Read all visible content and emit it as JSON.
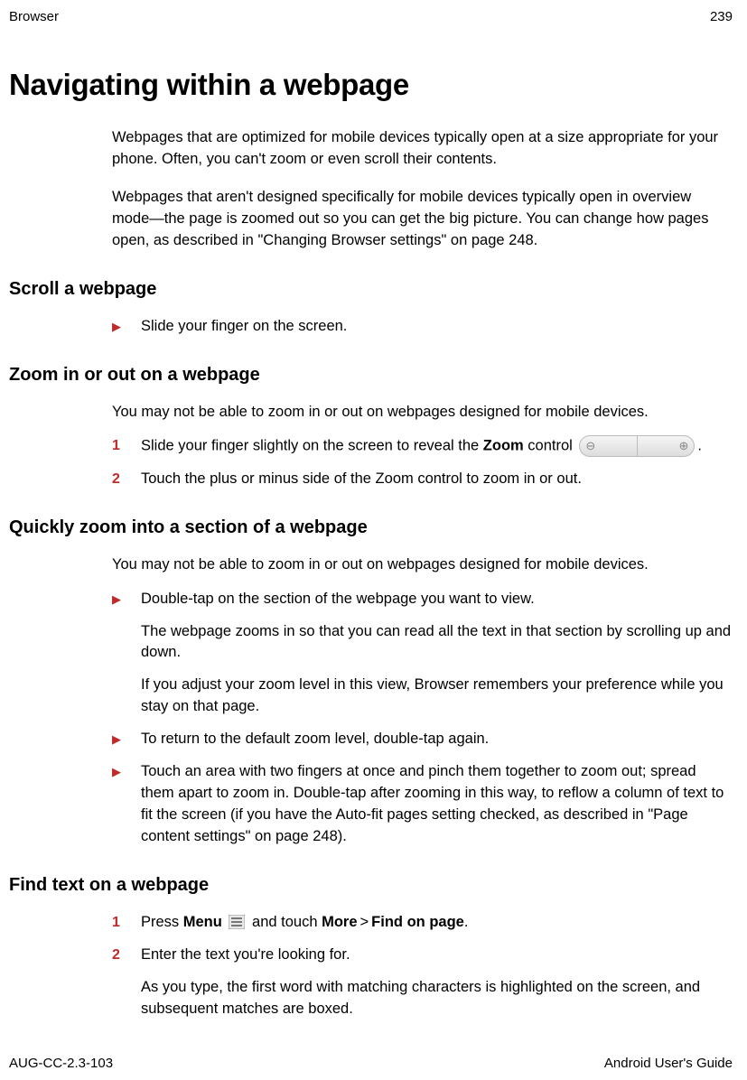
{
  "header": {
    "section": "Browser",
    "page_num": "239"
  },
  "title": "Navigating within a webpage",
  "intro1": "Webpages that are optimized for mobile devices typically open at a size appropriate for your phone. Often, you can't zoom or even scroll their contents.",
  "intro2": "Webpages that aren't designed specifically for mobile devices typically open in overview mode—the page is zoomed out so you can get the big picture. You can change how pages open, as described in \"Changing Browser settings\" on page 248.",
  "sections": {
    "scroll": {
      "heading": "Scroll a webpage",
      "b1": "Slide your finger on the screen."
    },
    "zoom": {
      "heading": "Zoom in or out on a webpage",
      "p1": "You may not be able to zoom in or out on webpages designed for mobile devices.",
      "s1a": "Slide your finger slightly on the screen to reveal the ",
      "s1b": "Zoom",
      "s1c": " control ",
      "s1d": ".",
      "s2": "Touch the plus or minus side of the Zoom control to zoom in or out."
    },
    "quick": {
      "heading": "Quickly zoom into a section of a webpage",
      "p1": "You may not be able to zoom in or out on webpages designed for mobile devices.",
      "b1": "Double-tap on the section of the webpage you want to view.",
      "b1p1": "The webpage zooms in so that you can read all the text in that section by scrolling up and down.",
      "b1p2": "If you adjust your zoom level in this view, Browser remembers your preference while you stay on that page.",
      "b2": "To return to the default zoom level, double-tap again.",
      "b3": "Touch an area with two fingers at once and pinch them together to zoom out; spread them apart to zoom in. Double-tap after zooming in this way, to reflow a column of text to fit the screen (if you have the Auto-fit pages setting checked, as described in \"Page content settings\" on page 248)."
    },
    "find": {
      "heading": "Find text on a webpage",
      "s1a": "Press ",
      "s1b": "Menu",
      "s1c": " and touch ",
      "s1d": "More",
      "s1sep": ">",
      "s1e": "Find on page",
      "s1f": ".",
      "s2": "Enter the text you're looking for.",
      "s2p1": "As you type, the first word with matching characters is highlighted on the screen, and subsequent matches are boxed."
    }
  },
  "footer": {
    "doc_id": "AUG-CC-2.3-103",
    "guide": "Android User's Guide"
  },
  "icons": {
    "zoom_minus": "⊖",
    "zoom_plus": "⊕"
  }
}
